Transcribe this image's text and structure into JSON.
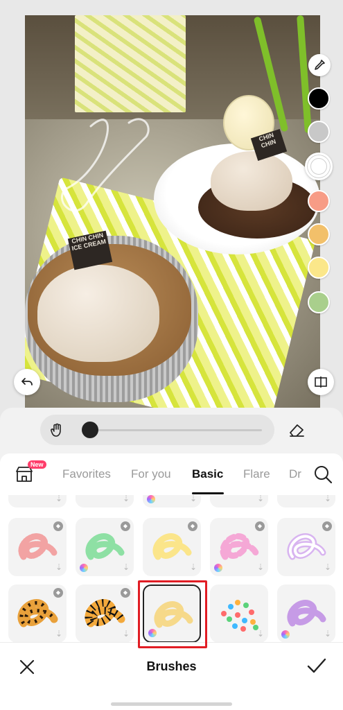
{
  "canvas": {
    "tag1_text": "CHIN CHIN ICE CREAM",
    "tag2_text": "CHIN CHIN"
  },
  "colors": {
    "swatches": [
      "#000000",
      "#c8c8c8",
      "#ffffff",
      "#f79c86",
      "#f2c06a",
      "#fbe78a",
      "#a9cf8c"
    ],
    "selected_swatch": "#ffffff",
    "accent": "#111111",
    "highlight": "#e11d24"
  },
  "toolbar": {
    "brush_size_fraction": 0.05
  },
  "tabs": {
    "new_badge": "New",
    "items": [
      "Favorites",
      "For you",
      "Basic",
      "Flare",
      "Dr"
    ],
    "active": "Basic"
  },
  "brushes": {
    "row1": [
      {
        "name": "pink-speckle-brush",
        "color": "#f2a3a3"
      },
      {
        "name": "green-brush",
        "color": "#8ee0a4"
      },
      {
        "name": "yellow-brush",
        "color": "#fbe58a"
      },
      {
        "name": "pink-dash-brush",
        "color": "#f5a8d6"
      },
      {
        "name": "lavender-outline-brush",
        "color": "#d8b4f0"
      }
    ],
    "row2": [
      {
        "name": "leopard-brush",
        "color": "#e9a13b"
      },
      {
        "name": "tiger-brush",
        "color": "#f3a93c"
      },
      {
        "name": "pastel-yellow-brush",
        "color": "#f6d98a",
        "selected": true
      },
      {
        "name": "confetti-dots-brush",
        "color": "#ff6b6b"
      },
      {
        "name": "purple-brush",
        "color": "#c69be6"
      }
    ]
  },
  "bottom_bar": {
    "title": "Brushes"
  }
}
